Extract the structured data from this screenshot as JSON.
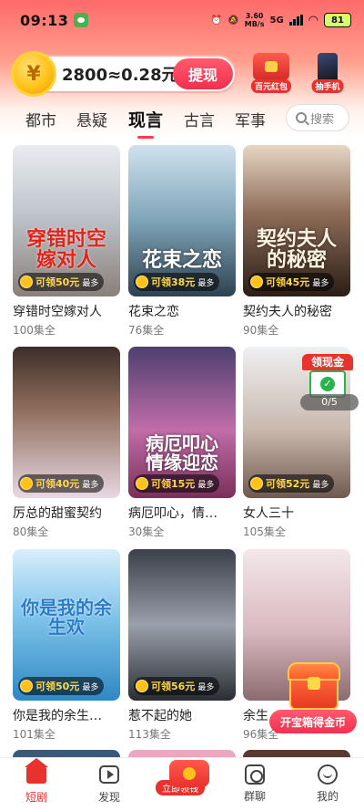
{
  "status_bar": {
    "time": "09:13",
    "net_speed_value": "3.60",
    "net_speed_unit": "MB/s",
    "network": "5G",
    "battery": "81"
  },
  "coins": {
    "amount_text": "2800≈0.28元",
    "coin_symbol": "¥",
    "withdraw_label": "提现"
  },
  "promos": [
    {
      "label": "百元红包"
    },
    {
      "label": "抽手机"
    }
  ],
  "category_tabs": [
    {
      "label": "都市"
    },
    {
      "label": "悬疑"
    },
    {
      "label": "现言",
      "selected": true
    },
    {
      "label": "古言"
    },
    {
      "label": "军事"
    }
  ],
  "search": {
    "placeholder": "搜索"
  },
  "dramas": [
    {
      "title": "穿错时空嫁对人",
      "episodes": "100集全",
      "poster_text": "穿错时空嫁对人",
      "reward": "可领50元",
      "reward_note": "最多"
    },
    {
      "title": "花束之恋",
      "episodes": "76集全",
      "poster_text": "花束之恋",
      "reward": "可领38元",
      "reward_note": "最多"
    },
    {
      "title": "契约夫人的秘密",
      "episodes": "90集全",
      "poster_text": "契约夫人的秘密",
      "reward": "可领45元",
      "reward_note": "最多"
    },
    {
      "title": "厉总的甜蜜契约",
      "episodes": "80集全",
      "poster_text": "",
      "reward": "可领40元",
      "reward_note": "最多"
    },
    {
      "title": "病厄叩心，情…",
      "episodes": "30集全",
      "poster_text": "病厄叩心 情缘迎恋",
      "reward": "可领15元",
      "reward_note": "最多"
    },
    {
      "title": "女人三十",
      "episodes": "105集全",
      "poster_text": "",
      "reward": "可领52元",
      "reward_note": "最多"
    },
    {
      "title": "你是我的余生…",
      "episodes": "101集全",
      "poster_text": "你是我的余生欢",
      "reward": "可领50元",
      "reward_note": "最多"
    },
    {
      "title": "惹不起的她",
      "episodes": "113集全",
      "poster_text": "",
      "reward": "可领56元",
      "reward_note": "最多"
    },
    {
      "title": "余生",
      "episodes": "96集全",
      "poster_text": "",
      "reward": "",
      "reward_note": ""
    }
  ],
  "cash_widget": {
    "label": "领现金",
    "progress": "0/5"
  },
  "treasure": {
    "button_label": "开宝箱得金币"
  },
  "bottom_nav": [
    {
      "label": "短剧",
      "active": true
    },
    {
      "label": "发现"
    },
    {
      "label": "立即领钱"
    },
    {
      "label": "群聊"
    },
    {
      "label": "我的"
    }
  ],
  "colors": {
    "accent": "#e8322e",
    "tab_underline": "#ff3b4e",
    "coin_gold": "#ffc21a"
  }
}
